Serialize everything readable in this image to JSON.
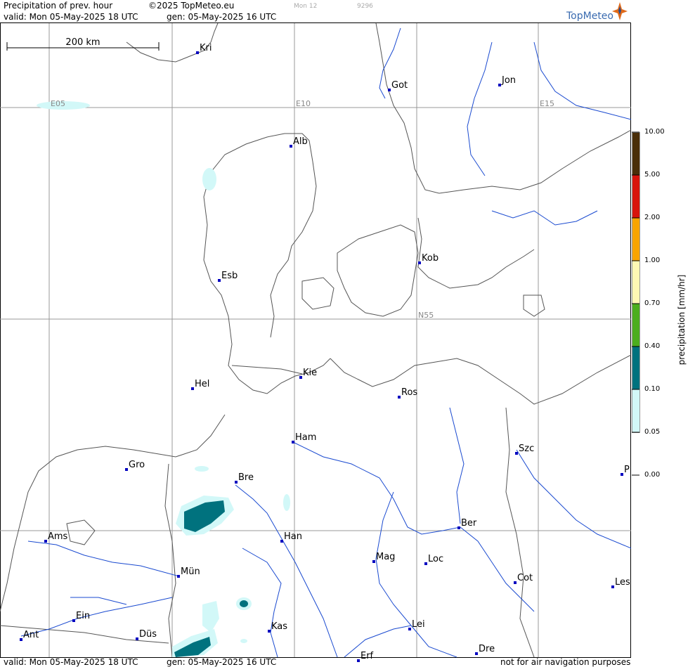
{
  "header": {
    "product": "Precipitation of prev. hour",
    "copyright": "©2025 TopMeteo.eu",
    "run_tag": "Mon 12",
    "run_code": "9296",
    "valid": "valid:  Mon  05-May-2025  18 UTC",
    "gen": "gen: 05-May-2025 16 UTC",
    "logo": "TopMeteo"
  },
  "footer": {
    "valid": "valid:  Mon  05-May-2025  18 UTC",
    "gen": "gen: 05-May-2025 16 UTC",
    "disclaimer": "not for air navigation purposes"
  },
  "scale_bar": {
    "label": "200 km"
  },
  "grid_labels": {
    "e05": "E05",
    "e10": "E10",
    "e15": "E15",
    "n55": "N55"
  },
  "legend": {
    "title": "precipitation  [mm/hr]",
    "labels": [
      "10.00",
      "5.00",
      "2.00",
      "1.00",
      "0.70",
      "0.40",
      "0.10",
      "0.05",
      "0.00"
    ],
    "colors": [
      "#4a2e08",
      "#d8140c",
      "#f8a400",
      "#fff8b4",
      "#4cae1e",
      "#00727e",
      "#d2f8f8"
    ]
  },
  "colors": {
    "water": "#1a4ad0",
    "coast": "#555555",
    "grid": "#999999",
    "city": "#0000c0"
  },
  "cities": [
    {
      "name": "Kri"
    },
    {
      "name": "Got"
    },
    {
      "name": "Jon"
    },
    {
      "name": "Alb"
    },
    {
      "name": "Esb"
    },
    {
      "name": "Kob"
    },
    {
      "name": "Kie"
    },
    {
      "name": "Hel"
    },
    {
      "name": "Ros"
    },
    {
      "name": "Ham"
    },
    {
      "name": "Szc"
    },
    {
      "name": "Gro"
    },
    {
      "name": "Bre"
    },
    {
      "name": "P"
    },
    {
      "name": "Ams"
    },
    {
      "name": "Han"
    },
    {
      "name": "Ber"
    },
    {
      "name": "Mag"
    },
    {
      "name": "Loc"
    },
    {
      "name": "Mün"
    },
    {
      "name": "Cot"
    },
    {
      "name": "Les"
    },
    {
      "name": "Ein"
    },
    {
      "name": "Kas"
    },
    {
      "name": "Lei"
    },
    {
      "name": "Ant"
    },
    {
      "name": "Düs"
    },
    {
      "name": "Dre"
    },
    {
      "name": "Erf"
    }
  ]
}
